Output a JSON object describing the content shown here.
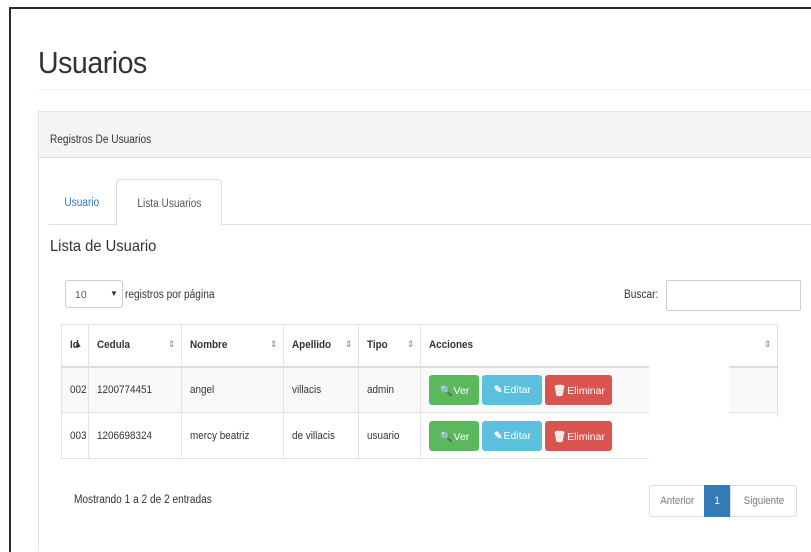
{
  "page": {
    "title": "Usuarios"
  },
  "panel": {
    "heading": "Registros De Usuarios"
  },
  "tabs": [
    {
      "label": "Usuario",
      "active": false
    },
    {
      "label": "Lista Usuarios",
      "active": true
    }
  ],
  "list": {
    "title": "Lista de Usuario",
    "length_value": "10",
    "length_label": "registros por página",
    "search_label": "Buscar:",
    "search_value": ""
  },
  "table": {
    "columns": [
      "Id",
      "Cedula",
      "Nombre",
      "Apellido",
      "Tipo",
      "Acciones"
    ],
    "rows": [
      {
        "id": "002",
        "cedula": "1200774451",
        "nombre": "angel",
        "apellido": "villacis",
        "tipo": "admin"
      },
      {
        "id": "003",
        "cedula": "1206698324",
        "nombre": "mercy beatriz",
        "apellido": "de villacis",
        "tipo": "usuario"
      }
    ],
    "actions": {
      "view": "Ver",
      "edit": "Editar",
      "delete": "Eliminar"
    }
  },
  "footer": {
    "info": "Mostrando 1 a 2 de 2 entradas",
    "prev": "Anterior",
    "page": "1",
    "next": "Siguiente"
  },
  "colors": {
    "view": "#5cb85c",
    "edit": "#5bc0de",
    "delete": "#d9534f",
    "primary": "#337ab7"
  },
  "icons": {
    "view": "search-plus-icon",
    "edit": "edit-icon",
    "delete": "trash-icon",
    "sort_asc": "sort-asc-icon",
    "sort_both": "sort-icon",
    "select_arrow": "caret-down-icon"
  }
}
